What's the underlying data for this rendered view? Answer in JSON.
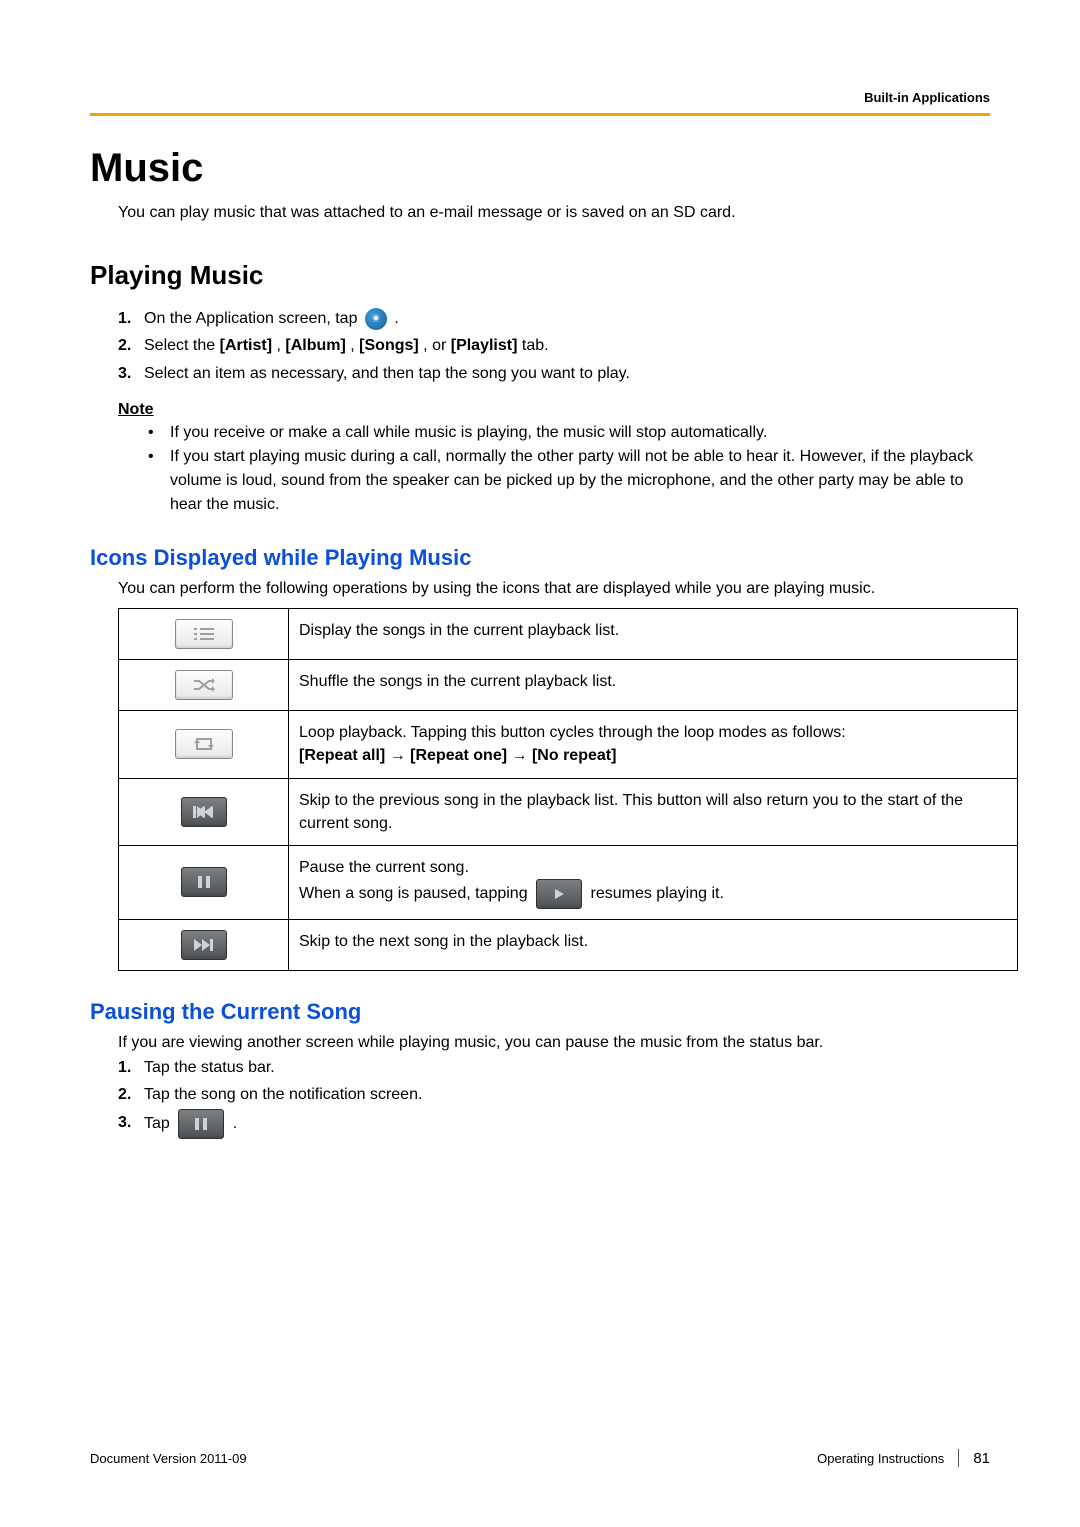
{
  "header": {
    "breadcrumb": "Built-in Applications"
  },
  "title": "Music",
  "intro": "You can play music that was attached to an e-mail message or is saved on an SD card.",
  "section_playing": {
    "heading": "Playing Music",
    "step1_prefix": "On the Application screen, tap ",
    "step1_suffix": " .",
    "step2_a": "Select the ",
    "step2_artist": "[Artist]",
    "step2_sep1": ", ",
    "step2_album": "[Album]",
    "step2_sep2": ", ",
    "step2_songs": "[Songs]",
    "step2_sep3": ", or ",
    "step2_playlist": "[Playlist]",
    "step2_b": " tab.",
    "step3": "Select an item as necessary, and then tap the song you want to play.",
    "note_label": "Note",
    "note1": "If you receive or make a call while music is playing, the music will stop automatically.",
    "note2": "If you start playing music during a call, normally the other party will not be able to hear it. However, if the playback volume is loud, sound from the speaker can be picked up by the microphone, and the other party may be able to hear the music."
  },
  "section_icons": {
    "heading": "Icons Displayed while Playing Music",
    "intro": "You can perform the following operations by using the icons that are displayed while you are playing music.",
    "rows": {
      "list": "Display the songs in the current playback list.",
      "shuffle": "Shuffle the songs in the current playback list.",
      "loop_a": "Loop playback. Tapping this button cycles through the loop modes as follows:",
      "loop_b1": "[Repeat all]",
      "loop_arrow": " → ",
      "loop_b2": "[Repeat one]",
      "loop_b3": "[No repeat]",
      "prev": "Skip to the previous song in the playback list. This button will also return you to the start of the current song.",
      "pause_a": "Pause the current song.",
      "pause_b_prefix": "When a song is paused, tapping ",
      "pause_b_suffix": " resumes playing it.",
      "next": "Skip to the next song in the playback list."
    }
  },
  "section_pausing": {
    "heading": "Pausing the Current Song",
    "intro": "If you are viewing another screen while playing music, you can pause the music from the status bar.",
    "step1": "Tap the status bar.",
    "step2": "Tap the song on the notification screen.",
    "step3_prefix": "Tap ",
    "step3_suffix": " ."
  },
  "footer": {
    "left": "Document Version  2011-09",
    "right_label": "Operating Instructions",
    "page": "81"
  }
}
